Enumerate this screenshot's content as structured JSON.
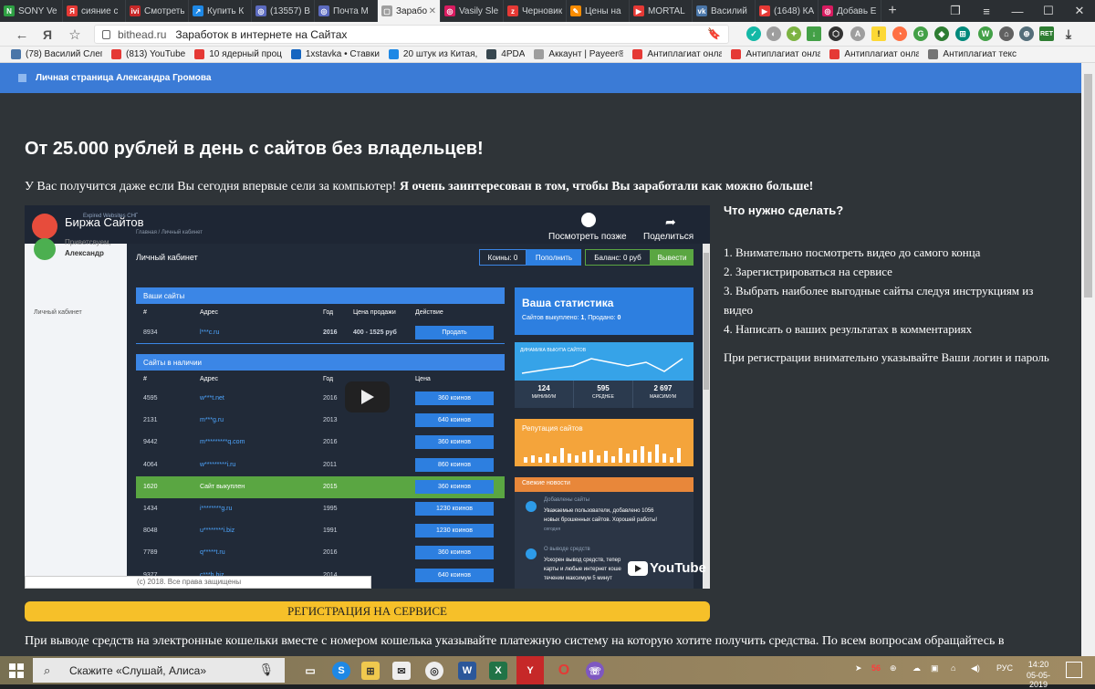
{
  "browser": {
    "tabs": [
      {
        "label": "SONY Ve",
        "color": "#2ea043",
        "glyph": "N"
      },
      {
        "label": "сияние с",
        "color": "#e53935",
        "glyph": "Я"
      },
      {
        "label": "Смотреть",
        "color": "#c62828",
        "glyph": "ivi"
      },
      {
        "label": "Купить К",
        "color": "#1e88e5",
        "glyph": "↗"
      },
      {
        "label": "(13557) В",
        "color": "#5c6bc0",
        "glyph": "◎"
      },
      {
        "label": "Почта М",
        "color": "#5c6bc0",
        "glyph": "◎"
      },
      {
        "label": "Зарабо",
        "color": "#9e9e9e",
        "glyph": "▢",
        "active": true
      },
      {
        "label": "Vasily Sle",
        "color": "#d81b60",
        "glyph": "◎"
      },
      {
        "label": "Черновик",
        "color": "#e53935",
        "glyph": "z"
      },
      {
        "label": "Цены на",
        "color": "#fb8c00",
        "glyph": "✎"
      },
      {
        "label": "MORTAL",
        "color": "#e53935",
        "glyph": "▶"
      },
      {
        "label": "Василий",
        "color": "#4a76a8",
        "glyph": "vk"
      },
      {
        "label": "(1648) КА",
        "color": "#e53935",
        "glyph": "▶"
      },
      {
        "label": "Добавь Е",
        "color": "#d81b60",
        "glyph": "◎"
      }
    ],
    "new_tab": "+",
    "address": {
      "domain": "bithead.ru",
      "title": "Заработок в интернете на Сайтах"
    },
    "bookmarks": [
      {
        "label": "(78) Василий Слеп",
        "color": "#4a76a8"
      },
      {
        "label": "(813) YouTube",
        "color": "#e53935"
      },
      {
        "label": "10 ядерный проц",
        "color": "#e53935"
      },
      {
        "label": "1xstavka • Ставки",
        "color": "#1565c0"
      },
      {
        "label": "20 штук из Китая,",
        "color": "#1e88e5"
      },
      {
        "label": "4PDA",
        "color": "#37474f"
      },
      {
        "label": "Аккаунт | Payeer®",
        "color": "#9e9e9e"
      },
      {
        "label": "Антиплагиат онла",
        "color": "#e53935"
      },
      {
        "label": "Антиплагиат онла",
        "color": "#e53935"
      },
      {
        "label": "Антиплагиат онла",
        "color": "#e53935"
      },
      {
        "label": "Антиплагиат текс",
        "color": "#757575"
      }
    ]
  },
  "page": {
    "topbar_title": "Личная страница Александра Громова",
    "headline": "От 25.000 рублей в день с сайтов без владельцев!",
    "intro_plain": "У Вас получится даже если Вы сегодня впервые сели за компьютер! ",
    "intro_bold": "Я очень заинтересован в том, чтобы Вы заработали как можно больше!",
    "right_heading": "Что нужно сделать?",
    "steps": [
      "1. Внимательно посмотреть видео до самого конца",
      "2. Зарегистрироваться на сервисе",
      "3. Выбрать наиболее выгодные сайты следуя инструкциям из видео",
      "4. Написать о ваших результатах в комментариях"
    ],
    "note": "При регистрации внимательно указывайте Ваши логин и пароль",
    "register_button": "РЕГИСТРАЦИЯ НА СЕРВИСЕ",
    "bottom_text": "При выводе средств на электронные кошельки вместе с номером кошелька указывайте платежную систему на которую хотите получить средства. По всем вопросам обращайтесь в"
  },
  "video": {
    "channel_title": "Биржа Сайтов",
    "watch_later": "Посмотреть позже",
    "share": "Поделиться",
    "brand_small": "Expired Websites СНГ",
    "greeting": "Приветсвуем,",
    "user": "Александр",
    "side_menu": "Личный кабинет",
    "breadcrumb": "Главная  /  Личный кабинет",
    "cabinet_title": "Личный кабинет",
    "coins": "Коины: 0",
    "topup": "Пополнить",
    "balance": "Баланс: 0 руб",
    "withdraw": "Вывести",
    "your_sites": "Ваши сайты",
    "available_sites": "Сайты в наличии",
    "cols_your": [
      "#",
      "Адрес",
      "Год",
      "Цена продажи",
      "Действие"
    ],
    "cols_avail": [
      "#",
      "Адрес",
      "Год",
      "Цена"
    ],
    "your_rows": [
      {
        "id": "8934",
        "addr": "l***c.ru",
        "year": "2016",
        "price": "400 - 1525 руб",
        "action": "Продать"
      }
    ],
    "avail_rows": [
      {
        "id": "4595",
        "addr": "w***t.net",
        "year": "2016",
        "price": "360 коинов"
      },
      {
        "id": "2131",
        "addr": "m***g.ru",
        "year": "2013",
        "price": "640 коинов"
      },
      {
        "id": "9442",
        "addr": "m*********q.com",
        "year": "2016",
        "price": "360 коинов"
      },
      {
        "id": "4064",
        "addr": "w*********i.ru",
        "year": "2011",
        "price": "860 коинов"
      },
      {
        "id": "1620",
        "addr": "Сайт выкуплен",
        "year": "2015",
        "price": "360 коинов",
        "sold": true
      },
      {
        "id": "1434",
        "addr": "i********g.ru",
        "year": "1995",
        "price": "1230 коинов"
      },
      {
        "id": "8048",
        "addr": "u********i.biz",
        "year": "1991",
        "price": "1230 коинов"
      },
      {
        "id": "7789",
        "addr": "q*****t.ru",
        "year": "2016",
        "price": "360 коинов"
      },
      {
        "id": "9377",
        "addr": "c***h.biz",
        "year": "2014",
        "price": "640 коинов"
      }
    ],
    "stats_title": "Ваша статистика",
    "stats_sub_a": "Сайтов выкуплено: ",
    "stats_bought": "1",
    "stats_sub_b": ", Продано: ",
    "stats_sold": "0",
    "dynamics_title": "ДИНАМИКА ВЫКУПА САЙТОВ",
    "dyn_values": [
      {
        "v": "124",
        "l": "МИНИМУМ"
      },
      {
        "v": "595",
        "l": "СРЕДНЕЕ"
      },
      {
        "v": "2 697",
        "l": "МАКСИМУМ"
      }
    ],
    "reputation_title": "Репутация сайтов",
    "news_title": "Свежие новости",
    "news1_head": "Добавлены сайты",
    "news1_body_1": "Уважаемые пользователи, добавлено 1056",
    "news1_body_2": "новых брошенных сайтов. Хорошей работы!",
    "news1_time": "сегодня",
    "news2_head": "О выводе средств",
    "news2_body_1": "Ускорен вывод средств, тепер",
    "news2_body_2": "карты и любые интернет коше",
    "news2_body_3": "течении максимум 5 минут",
    "copyright": "(c) 2018. Все права защищены",
    "youtube": "YouTube"
  },
  "taskbar": {
    "search_placeholder": "Скажите «Слушай, Алиса»",
    "lang": "РУС",
    "time": "14:20",
    "date": "05-05-2019",
    "badge": "56"
  }
}
